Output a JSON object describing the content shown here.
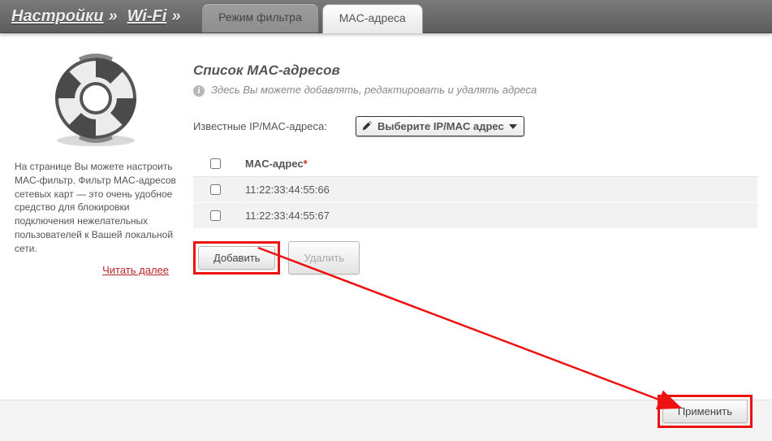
{
  "breadcrumb": {
    "root": "Настройки",
    "sep": "»",
    "section": "Wi-Fi",
    "sep2": "»"
  },
  "tabs": {
    "filter_mode": "Режим фильтра",
    "mac_addresses": "MAC-адреса"
  },
  "sidebar": {
    "description": "На странице Вы можете настроить MAC-фильтр. Фильтр MAC-адресов сетевых карт — это очень удобное средство для блокировки подключения нежелательных пользователей к Вашей локальной сети.",
    "read_more": "Читать далее"
  },
  "main": {
    "title": "Список MAC-адресов",
    "hint": "Здесь Вы можете добавлять, редактировать и удалять адреса",
    "known_label": "Известные IP/MAC-адреса:",
    "select_placeholder": "Выберите IP/MAC адрес",
    "table": {
      "header_mac": "MAC-адрес",
      "required_mark": "*",
      "rows": [
        {
          "mac": "11:22:33:44:55:66"
        },
        {
          "mac": "11:22:33:44:55:67"
        }
      ]
    },
    "buttons": {
      "add": "Добавить",
      "delete": "Удалить",
      "apply": "Применить"
    }
  }
}
